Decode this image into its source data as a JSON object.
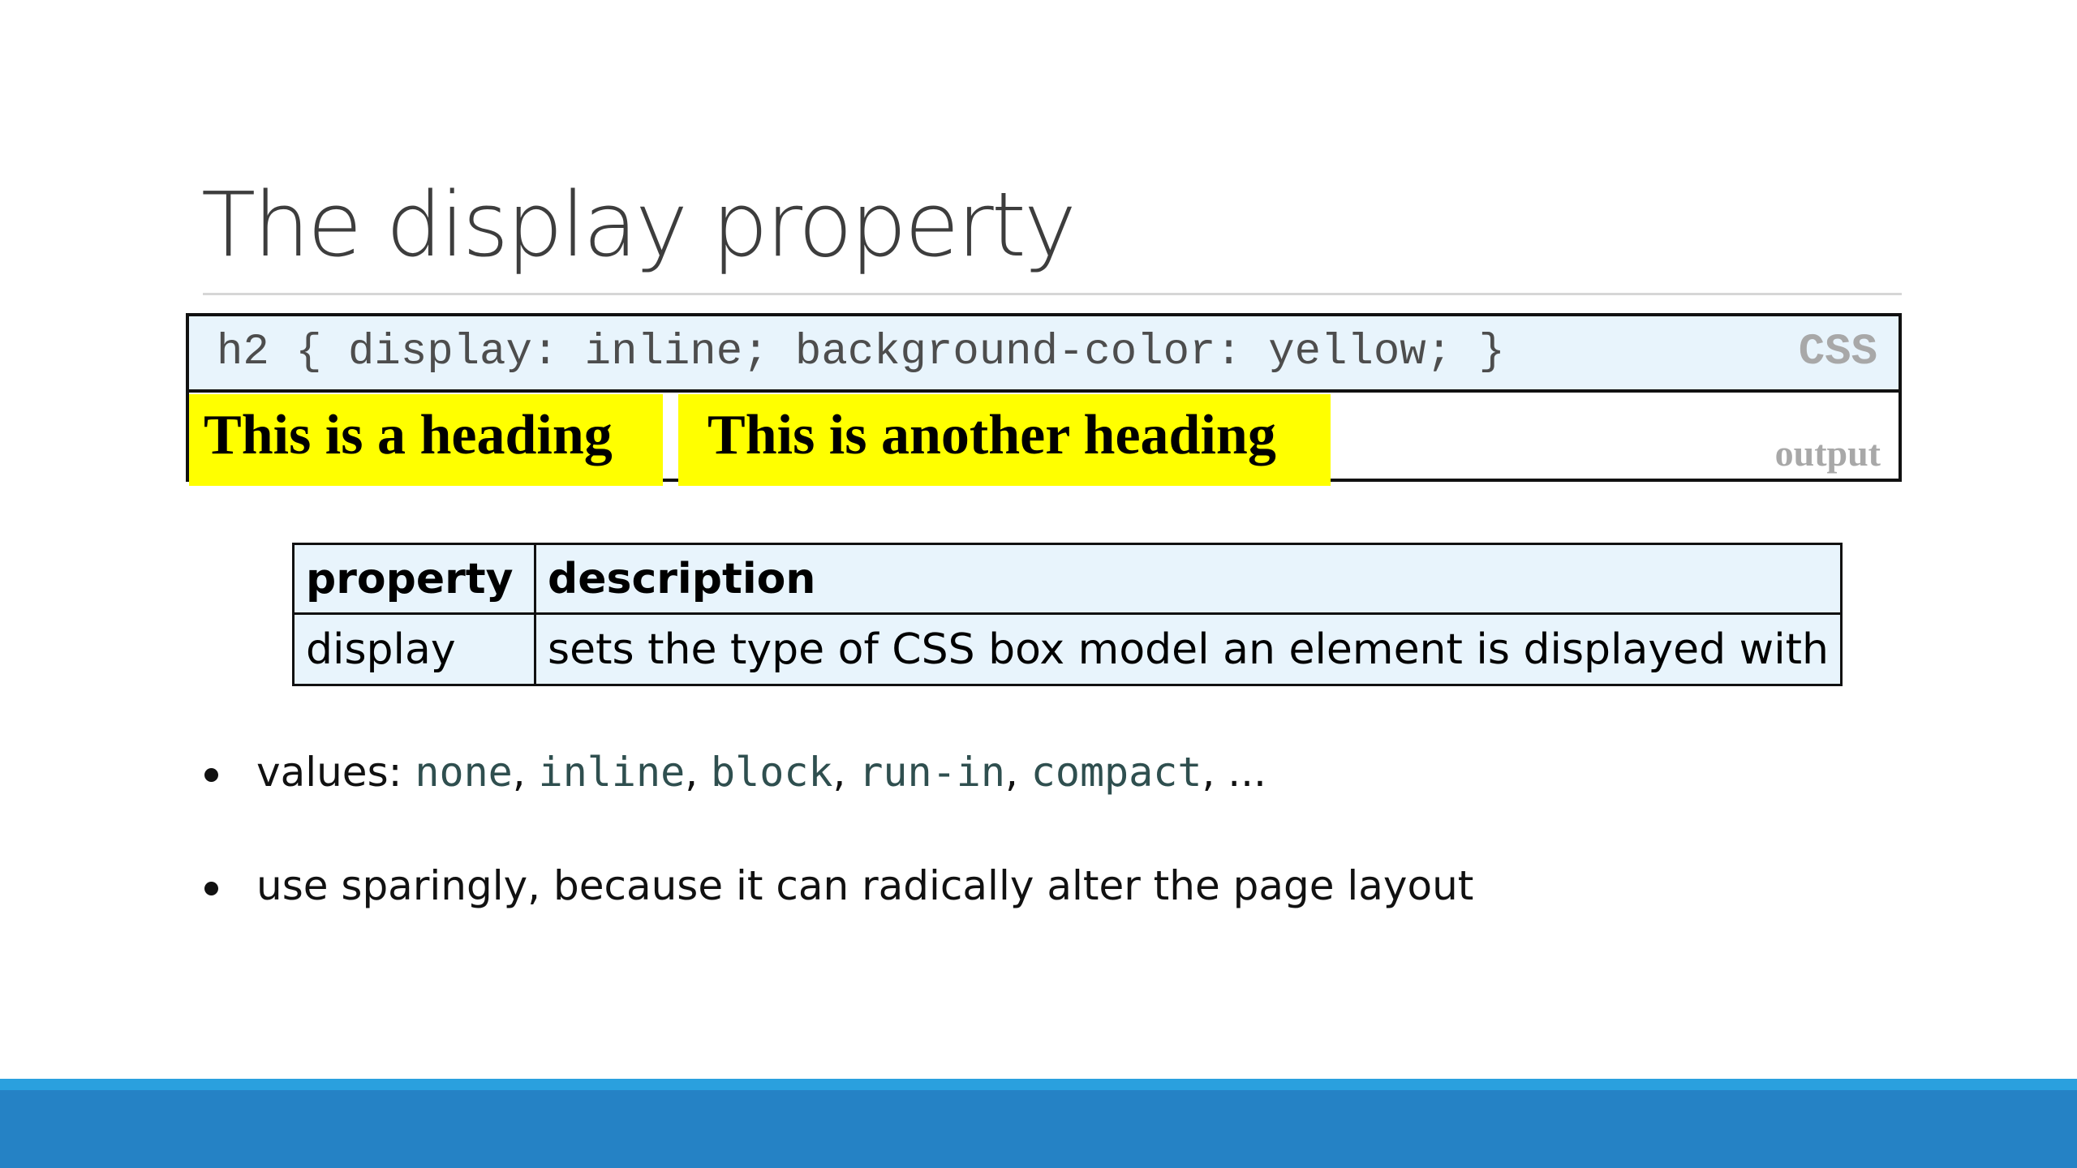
{
  "slide": {
    "title": "The display property"
  },
  "example": {
    "css_code": "h2 { display: inline; background-color: yellow; }",
    "css_tag": "CSS",
    "heading_1": "This is a heading",
    "heading_2": "This is another heading",
    "output_tag": "output",
    "heading_background": "#ffff00"
  },
  "table": {
    "headers": [
      "property",
      "description"
    ],
    "rows": [
      [
        "display",
        "sets the type of CSS box model an element is displayed with"
      ]
    ],
    "background": "#e8f4fc"
  },
  "bullets": {
    "values_label": "values: ",
    "values": [
      "none",
      "inline",
      "block",
      "run-in",
      "compact"
    ],
    "separator": ", ",
    "ellipsis": "...",
    "note": "use sparingly, because it can radically alter the page layout"
  },
  "colors": {
    "footer_stripe": "#2aa0de",
    "footer_bar": "#2582c5"
  }
}
